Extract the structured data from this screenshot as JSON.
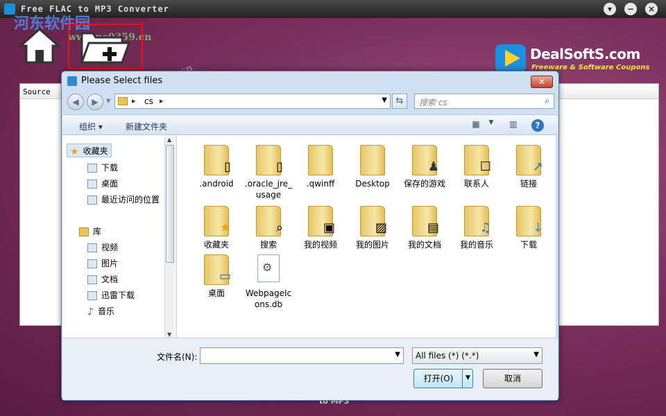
{
  "app": {
    "title": "Free FLAC to MP3 Converter",
    "bottom_text": "to MP3"
  },
  "watermark": {
    "site": "河东软件园",
    "url": "www.pc0359.cn",
    "url_short": "pc0359.cn"
  },
  "brand": {
    "name": "DealSoftS.com",
    "tagline": "Freeware & Software Coupons"
  },
  "main": {
    "source_header": "Source"
  },
  "dialog": {
    "title": "Please Select files",
    "close_label": "✕",
    "address": {
      "crumb": "cs"
    },
    "search_placeholder": "搜索 cs",
    "toolbar": {
      "organize": "组织 ▾",
      "new_folder": "新建文件夹"
    },
    "nav": {
      "favorites": "收藏夹",
      "downloads": "下载",
      "desktop": "桌面",
      "recent": "最近访问的位置",
      "libraries": "库",
      "videos": "视频",
      "pictures": "图片",
      "documents": "文档",
      "xunlei": "迅雷下载",
      "music": "音乐"
    },
    "files": [
      {
        "name": ".android",
        "type": "folder",
        "icon": "doc-folder"
      },
      {
        "name": ".oracle_jre_usage",
        "type": "folder",
        "icon": "doc-folder"
      },
      {
        "name": ".qwinff",
        "type": "folder",
        "icon": "folder"
      },
      {
        "name": "Desktop",
        "type": "folder",
        "icon": "folder"
      },
      {
        "name": "保存的游戏",
        "type": "folder",
        "icon": "chess-icon"
      },
      {
        "name": "联系人",
        "type": "folder",
        "icon": "contact-icon"
      },
      {
        "name": "链接",
        "type": "folder",
        "icon": "arrow-icon"
      },
      {
        "name": "收藏夹",
        "type": "folder",
        "icon": "star-icon"
      },
      {
        "name": "搜索",
        "type": "folder",
        "icon": "magnifier-icon"
      },
      {
        "name": "我的视频",
        "type": "folder",
        "icon": "film-icon"
      },
      {
        "name": "我的图片",
        "type": "folder",
        "icon": "picture-icon"
      },
      {
        "name": "我的文档",
        "type": "folder",
        "icon": "document-icon"
      },
      {
        "name": "我的音乐",
        "type": "folder",
        "icon": "music-icon"
      },
      {
        "name": "下载",
        "type": "folder",
        "icon": "download-icon"
      },
      {
        "name": "桌面",
        "type": "folder",
        "icon": "monitor-icon"
      },
      {
        "name": "WebpageIcons.db",
        "type": "file",
        "icon": "gear-file-icon"
      }
    ],
    "filename_label": "文件名(N):",
    "filename_value": "",
    "filetype_value": "All files (*) (*.*)",
    "open_label": "打开(O)",
    "cancel_label": "取消"
  },
  "colors": {
    "accent": "#7b2f5c",
    "highlight": "#e3121c",
    "brand_sub": "#ffe24a"
  }
}
